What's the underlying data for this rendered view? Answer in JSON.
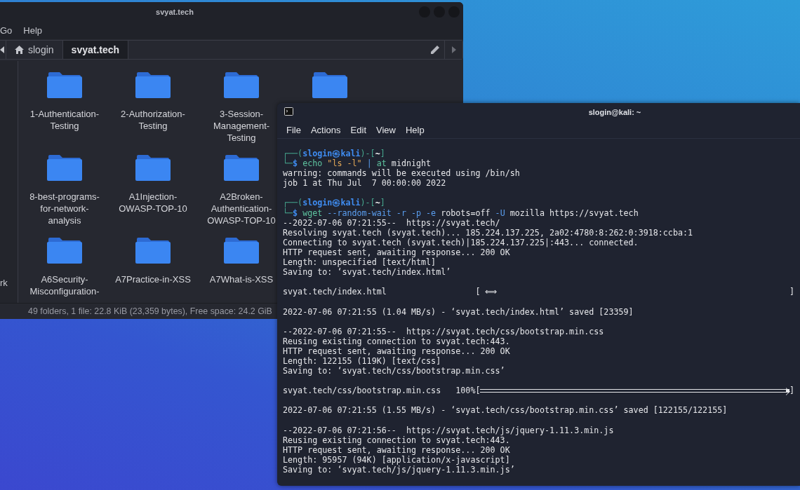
{
  "file_manager": {
    "title": "svyat.tech",
    "menu": [
      "Go",
      "Help"
    ],
    "path": [
      {
        "label": "slogin",
        "kind": "home",
        "selected": false
      },
      {
        "label": "svyat.tech",
        "kind": "folder",
        "selected": true
      }
    ],
    "sidebar": [
      "rk"
    ],
    "folder_rows": [
      [
        {
          "kind": "folder",
          "name": "1-Authentication-Testing"
        },
        {
          "kind": "folder",
          "name": "2-Authorization-Testing"
        },
        {
          "kind": "folder",
          "name": "3-Session-Management-Testing"
        },
        {
          "kind": "folder"
        }
      ],
      [
        {
          "kind": "folder",
          "name": "8-best-programs-for-network-analysis"
        },
        {
          "kind": "folder",
          "name": "A1Injection-OWASP-TOP-10"
        },
        {
          "kind": "folder",
          "name": "A2Broken-Authentication-OWASP-TOP-10"
        }
      ],
      [
        {
          "kind": "folder",
          "name": "A6Security-Misconfiguration-"
        },
        {
          "kind": "folder",
          "name": "A7Practice-in-XSS"
        },
        {
          "kind": "folder",
          "name": "A7What-is-XSS"
        }
      ]
    ],
    "status": "49 folders, 1 file: 22.8 KiB (23,359 bytes), Free space: 24.2 GiB"
  },
  "terminal": {
    "title": "slogin@kali: ~",
    "menu": [
      "File",
      "Actions",
      "Edit",
      "View",
      "Help"
    ],
    "blocks": [
      {
        "lines": [
          {
            "segments": [
              {
                "text": "┌──(",
                "kind": "frame"
              },
              {
                "text": "slogin㉿kali",
                "kind": "user"
              },
              {
                "text": ")-[",
                "kind": "frame"
              },
              {
                "text": "~",
                "kind": "dir"
              },
              {
                "text": "]",
                "kind": "frame"
              }
            ]
          },
          {
            "segments": [
              {
                "text": "└─",
                "kind": "frame"
              },
              {
                "text": "$",
                "kind": "user"
              },
              {
                "text": " echo",
                "kind": "cmd"
              },
              {
                "text": " \"ls -l\"",
                "kind": "string"
              },
              {
                "text": " |",
                "kind": "option"
              },
              {
                "text": " at",
                "kind": "cmd"
              },
              {
                "text": " midnight",
                "kind": "plain"
              }
            ]
          },
          {
            "text": "warning: commands will be executed using /bin/sh"
          },
          {
            "text": "job 1 at Thu Jul  7 00:00:00 2022"
          }
        ]
      },
      {
        "lines": [
          {
            "segments": [
              {
                "text": "┌──(",
                "kind": "frame"
              },
              {
                "text": "slogin㉿kali",
                "kind": "user"
              },
              {
                "text": ")-[",
                "kind": "frame"
              },
              {
                "text": "~",
                "kind": "dir"
              },
              {
                "text": "]",
                "kind": "frame"
              }
            ]
          },
          {
            "segments": [
              {
                "text": "└─",
                "kind": "frame"
              },
              {
                "text": "$",
                "kind": "user"
              },
              {
                "text": " wget",
                "kind": "cmd"
              },
              {
                "text": " --random-wait -r -p -e",
                "kind": "option"
              },
              {
                "text": " robots=off",
                "kind": "plain"
              },
              {
                "text": " -U",
                "kind": "option"
              },
              {
                "text": " mozilla https://svyat.tech",
                "kind": "plain"
              }
            ]
          },
          {
            "text": "--2022-07-06 07:21:55--  https://svyat.tech/"
          },
          {
            "text": "Resolving svyat.tech (svyat.tech)... 185.224.137.225, 2a02:4780:8:262:0:3918:ccba:1"
          },
          {
            "text": "Connecting to svyat.tech (svyat.tech)|185.224.137.225|:443... connected."
          },
          {
            "text": "HTTP request sent, awaiting response... 200 OK"
          },
          {
            "text": "Length: unspecified [text/html]"
          },
          {
            "text": "Saving to: ‘svyat.tech/index.html’"
          }
        ]
      },
      {
        "lines": [
          {
            "kind": "progress",
            "label": "svyat.tech/index.html",
            "open": "[",
            "marker": "⟺",
            "close": "]"
          }
        ]
      },
      {
        "lines": [
          {
            "text": "2022-07-06 07:21:55 (1.04 MB/s) - ‘svyat.tech/index.html’ saved [23359]"
          }
        ]
      },
      {
        "lines": [
          {
            "text": "--2022-07-06 07:21:55--  https://svyat.tech/css/bootstrap.min.css"
          },
          {
            "text": "Reusing existing connection to svyat.tech:443."
          },
          {
            "text": "HTTP request sent, awaiting response... 200 OK"
          },
          {
            "text": "Length: 122155 (119K) [text/css]"
          },
          {
            "text": "Saving to: ‘svyat.tech/css/bootstrap.min.css’"
          }
        ]
      },
      {
        "lines": [
          {
            "kind": "progress",
            "label": "svyat.tech/css/bootstrap.min.css",
            "percent": "100%",
            "open": "[",
            "level": 1,
            "close": "]"
          }
        ]
      },
      {
        "lines": [
          {
            "text": "2022-07-06 07:21:55 (1.55 MB/s) - ‘svyat.tech/css/bootstrap.min.css’ saved [122155/122155]"
          }
        ]
      },
      {
        "lines": [
          {
            "text": "--2022-07-06 07:21:56--  https://svyat.tech/js/jquery-1.11.3.min.js"
          },
          {
            "text": "Reusing existing connection to svyat.tech:443."
          },
          {
            "text": "HTTP request sent, awaiting response... 200 OK"
          },
          {
            "text": "Length: 95957 (94K) [application/x-javascript]"
          },
          {
            "text": "Saving to: ‘svyat.tech/js/jquery-1.11.3.min.js’"
          }
        ]
      }
    ]
  }
}
